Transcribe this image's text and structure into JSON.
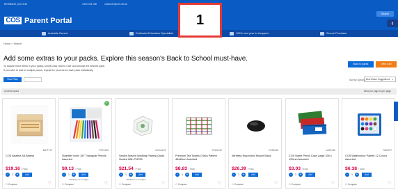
{
  "topbar": {
    "location": "BRISBANE QLD 4119",
    "phone": "1300 018 158",
    "email": "customer@cos.net.au",
    "brand": "Parent Portal",
    "logo": "COS",
    "search_label": "Search",
    "menu_glyph": "‹"
  },
  "nav": {
    "items": [
      {
        "label": "Australia Owned"
      },
      {
        "label": "Dedicated Education Specialists"
      },
      {
        "label": "100% next year to shoppers"
      },
      {
        "label": "Secure Purchase"
      }
    ]
  },
  "callout": {
    "label": "1"
  },
  "breadcrumb": "Home > Search",
  "page": {
    "headline": "Add some extras to your packs. Explore this season's Back to School must-have.",
    "subtext_1": "To include more items in your packs, simply click 'Add to Cart' and choose the desired pack.",
    "subtext_2": "If you wish to add to multiple packs, repeat the process for each pack individually.",
    "back_to_packs": "Back to packs",
    "view_cart": "View Cart"
  },
  "filters": {
    "button": "View Filter",
    "sort_label": "Sort by Options",
    "sort_value": "Best Match Suggestions"
  },
  "results": {
    "count_text": "16 items found",
    "per_page_text": "Items per page 16 per page"
  },
  "products": [
    {
      "sku": "BATT179",
      "name": "COS Alkaline AA Battery",
      "price": "$19.16",
      "unit": "/ Pack",
      "qty": "1",
      "add": "Add",
      "delivery": "",
      "compare": "Compare",
      "badge": false
    },
    {
      "sku": "PSTC245",
      "name": "Staedtler Noris 187 Triangular Pencils Assorted",
      "price": "$9.13",
      "unit": "/ Pack",
      "qty": "1",
      "add": "Add",
      "delivery": "Delivery in 3-4 days",
      "compare": "Compare",
      "badge": true
    },
    {
      "sku": "MCKA178",
      "name": "Sealed Waves Seedling Playing Cards Sealed With Pf4783",
      "price": "$21.54",
      "unit": "/ Pack",
      "qty": "1",
      "add": "Add",
      "delivery": "Delivery in 3-4 days",
      "compare": "Compare",
      "badge": false
    },
    {
      "sku": "TOWL022",
      "name": "Premium Tea Towels Check Pattern 45x65cm Assorted",
      "price": "$8.83",
      "unit": "/ Pack",
      "qty": "1",
      "add": "Add",
      "delivery": "",
      "compare": "Compare",
      "badge": false
    },
    {
      "sku": "DTAB136",
      "name": "Wireless Ergonomic Mouse Black",
      "price": "$26.39",
      "unit": "/ Pack",
      "qty": "1",
      "add": "Add",
      "delivery": "",
      "compare": "Compare",
      "badge": false
    },
    {
      "sku": "CASE148",
      "name": "COS Name Pencil Case Large 330 x 190mm Assorted",
      "price": "$3.03",
      "unit": "/ Each",
      "qty": "1",
      "add": "Add",
      "delivery": "",
      "compare": "Compare",
      "badge": false
    },
    {
      "sku": "PAIN237",
      "name": "COS Watercolour Palette 12 Colour Assorted",
      "price": "$6.38",
      "unit": "/ Each",
      "qty": "1",
      "add": "Add",
      "delivery": "",
      "compare": "Compare",
      "badge": false
    }
  ],
  "colors": {
    "brand_blue": "#0a5bc4",
    "price_red": "#d4004b",
    "cart_orange": "#f07d18",
    "callout_red": "#e53935"
  }
}
